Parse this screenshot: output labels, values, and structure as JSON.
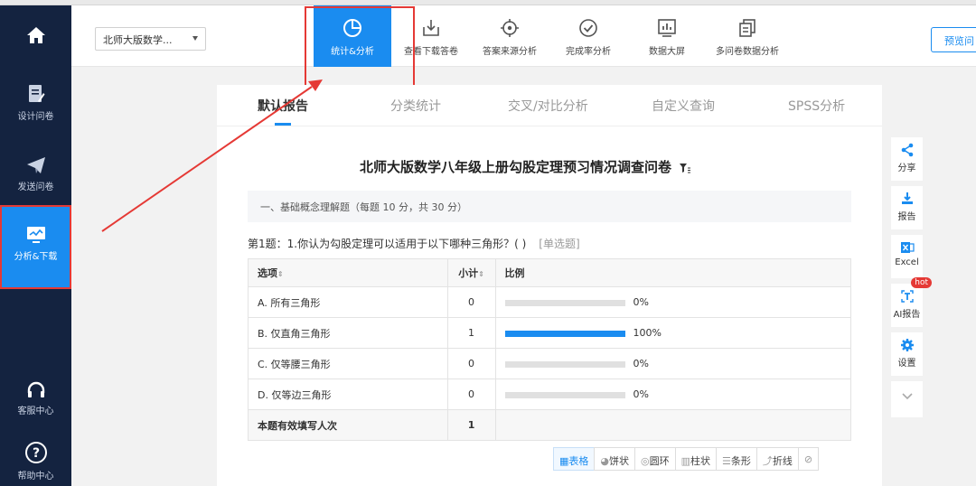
{
  "sidebar": {
    "items": [
      {
        "label": ""
      },
      {
        "label": "设计问卷"
      },
      {
        "label": "发送问卷"
      },
      {
        "label": "分析&下载"
      },
      {
        "label": "客服中心"
      },
      {
        "label": "帮助中心"
      }
    ]
  },
  "header": {
    "survey_select": "北师大版数学...",
    "tools": [
      {
        "label": "统计&分析"
      },
      {
        "label": "查看下载答卷"
      },
      {
        "label": "答案来源分析"
      },
      {
        "label": "完成率分析"
      },
      {
        "label": "数据大屏"
      },
      {
        "label": "多问卷数据分析"
      }
    ],
    "preview_label": "预览问"
  },
  "tabs": [
    "默认报告",
    "分类统计",
    "交叉/对比分析",
    "自定义查询",
    "SPSS分析"
  ],
  "report": {
    "title": "北师大版数学八年级上册勾股定理预习情况调查问卷",
    "section": "一、基础概念理解题（每题 10 分，共 30 分）",
    "question": "第1题：1.你认为勾股定理可以适用于以下哪种三角形？( )",
    "question_type": "[单选题]",
    "table": {
      "headers": [
        "选项",
        "小计",
        "比例"
      ],
      "rows": [
        {
          "option": "A. 所有三角形",
          "count": "0",
          "pct_label": "0%",
          "pct": 0
        },
        {
          "option": "B. 仅直角三角形",
          "count": "1",
          "pct_label": "100%",
          "pct": 100
        },
        {
          "option": "C. 仅等腰三角形",
          "count": "0",
          "pct_label": "0%",
          "pct": 0
        },
        {
          "option": "D. 仅等边三角形",
          "count": "0",
          "pct_label": "0%",
          "pct": 0
        }
      ],
      "total_label": "本题有效填写人次",
      "total_count": "1"
    },
    "chart_types": [
      "表格",
      "饼状",
      "圆环",
      "柱状",
      "条形",
      "折线"
    ]
  },
  "rightbar": {
    "share": "分享",
    "report": "报告",
    "excel": "Excel",
    "ai_report": "AI报告",
    "hot": "hot",
    "settings": "设置"
  },
  "colors": {
    "accent": "#1a8cf0",
    "sidebar": "#142340",
    "highlight": "#e53935"
  }
}
